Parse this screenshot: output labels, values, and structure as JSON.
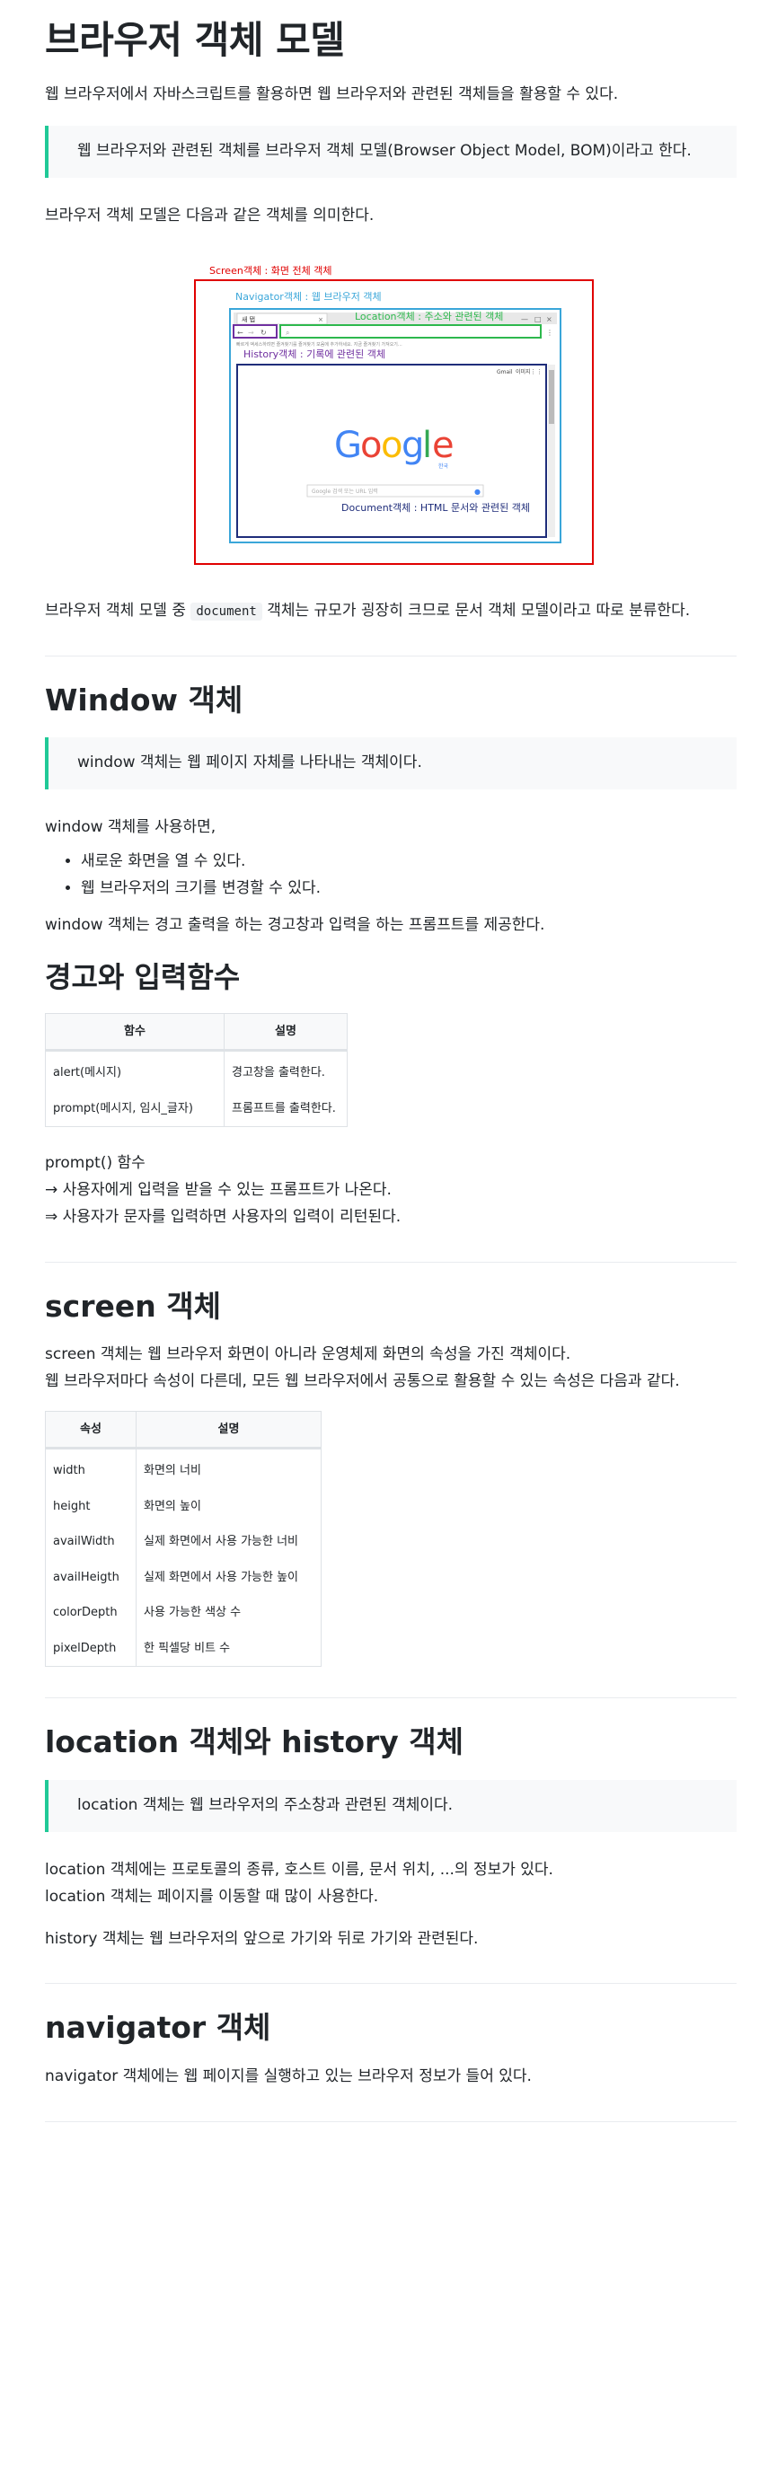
{
  "bom_section": {
    "title": "브라우저 객체 모델",
    "intro": "웹 브라우저에서 자바스크립트를 활용하면 웹 브라우저와 관련된 객체들을 활용할 수 있다.",
    "quote": "웹 브라우저와 관련된 객체를 브라우저 객체 모델(Browser Object Model, BOM)이라고 한다.",
    "meaning": "브라우저 객체 모델은 다음과 같은 객체를 의미한다.",
    "document_note_before": "브라우저 객체 모델 중 ",
    "document_note_code": "document",
    "document_note_after": " 객체는 규모가 굉장히 크므로 문서 객체 모델이라고 따로 분류한다."
  },
  "diagram": {
    "screen_label": "Screen객체 : 화면 전체 객체",
    "navigator_label": "Navigator객체 : 웹 브라우저 객체",
    "location_label": "Location객체 : 주소와 관련된 객체",
    "history_label": "History객체 : 기록에 관련된 객체",
    "document_label": "Document객체 : HTML 문서와 관련된 객체",
    "tab_label": "새 탭",
    "bookmark_hint": "빠르게 액세스하려면 즐겨찾기를 즐겨찾기 모음에 추가하세요. 지금 즐겨찾기 가져오기...",
    "top_links": [
      "Gmail",
      "이미지"
    ],
    "logo_sub": "한국",
    "search_placeholder": "Google 검색 또는 URL 입력",
    "colors": {
      "screen": "#e00000",
      "navigator": "#3aa6d9",
      "location": "#2db84d",
      "history": "#7030a0",
      "document": "#1f2d7a"
    }
  },
  "window_section": {
    "title": "Window 객체",
    "quote": "window 객체는 웹 페이지 자체를 나타내는 객체이다.",
    "using": "window 객체를 사용하면,",
    "bullets": [
      "새로운 화면을 열 수 있다.",
      "웹 브라우저의 크기를 변경할 수 있다."
    ],
    "prompt_note": "window 객체는 경고 출력을 하는 경고창과 입력을 하는 프롬프트를 제공한다."
  },
  "alert_section": {
    "title": "경고와 입력함수",
    "headers": [
      "함수",
      "설명"
    ],
    "rows": [
      [
        "alert(메시지)",
        "경고창을 출력한다."
      ],
      [
        "prompt(메시지, 임시_글자)",
        "프롬프트를 출력한다."
      ]
    ],
    "lines": [
      "prompt() 함수",
      "→ 사용자에게 입력을 받을 수 있는 프롬프트가 나온다.",
      "⇒ 사용자가 문자를 입력하면 사용자의 입력이 리턴된다."
    ]
  },
  "screen_section": {
    "title": "screen 객체",
    "line1": "screen 객체는 웹 브라우저 화면이 아니라 운영체제 화면의 속성을 가진 객체이다.",
    "line2": "웹 브라우저마다 속성이 다른데, 모든 웹 브라우저에서 공통으로 활용할 수 있는 속성은 다음과 같다.",
    "headers": [
      "속성",
      "설명"
    ],
    "rows": [
      [
        "width",
        "화면의 너비"
      ],
      [
        "height",
        "화면의 높이"
      ],
      [
        "availWidth",
        "실제 화면에서 사용 가능한 너비"
      ],
      [
        "availHeigth",
        "실제 화면에서 사용 가능한 높이"
      ],
      [
        "colorDepth",
        "사용 가능한 색상 수"
      ],
      [
        "pixelDepth",
        "한 픽셀당 비트 수"
      ]
    ]
  },
  "location_section": {
    "title": "location 객체와 history 객체",
    "quote": "location 객체는 웹 브라우저의 주소창과 관련된 객체이다.",
    "line1": "location 객체에는 프로토콜의 종류, 호스트 이름, 문서 위치, ...의 정보가 있다.",
    "line2": "location 객체는 페이지를 이동할 때 많이 사용한다.",
    "history": "history 객체는 웹 브라우저의 앞으로 가기와 뒤로 가기와 관련된다."
  },
  "navigator_section": {
    "title": "navigator 객체",
    "line": "navigator 객체에는 웹 페이지를 실행하고 있는 브라우저 정보가 들어 있다."
  }
}
